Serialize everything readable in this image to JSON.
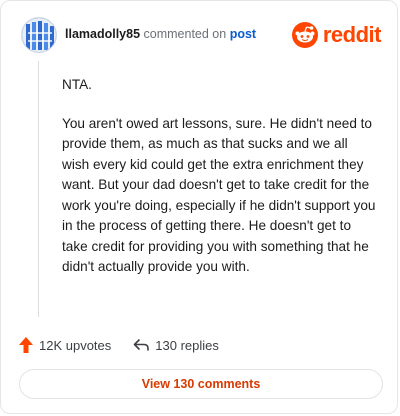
{
  "header": {
    "username": "llamadolly85",
    "action_text": "commented on",
    "target_link": "post",
    "brand_name": "reddit",
    "brand_color": "#ff4500"
  },
  "avatar": {
    "icon": "user-avatar-icon"
  },
  "comment": {
    "paragraphs": [
      "NTA.",
      "You aren't owed art lessons, sure. He didn't need to provide them, as much as that sucks and we all wish every kid could get the extra enrichment they want. But your dad doesn't get to take credit for the work you're doing, especially if he didn't support you in the process of getting there. He doesn't get to take credit for providing you with something that he didn't actually provide you with."
    ]
  },
  "actions": {
    "upvotes": "12K upvotes",
    "replies": "130 replies",
    "upvote_color": "#ff4500"
  },
  "footer": {
    "view_comments_label": "View 130 comments"
  }
}
